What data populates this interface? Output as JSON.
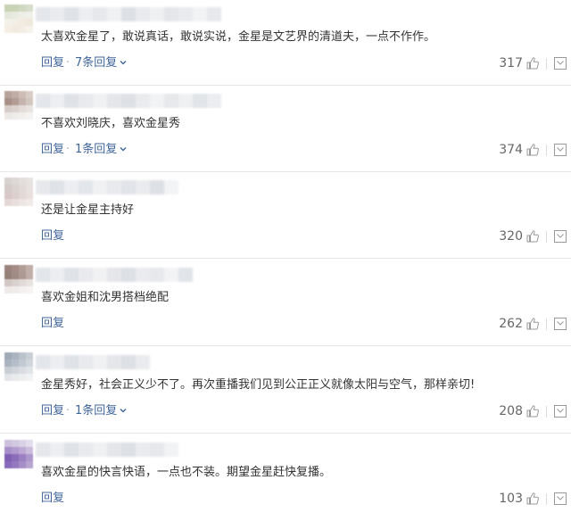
{
  "reply_label": "回复",
  "comments": [
    {
      "avatar_colors": [
        "#c7d3b4",
        "#c9d4b7",
        "#d0d8c2",
        "#d7ddcb",
        "#e4e8da",
        "#e8ebe0",
        "#eeeee6",
        "#f0f0ea",
        "#f4f1ea",
        "#f3efe6",
        "#f1ebe1",
        "#efe8dc",
        "#f5eee5",
        "#f2ebe1",
        "#f3ede5",
        "#f6f2ec"
      ],
      "name_colors": [
        "#e3e6ea",
        "#e9ebef",
        "#dfe2e7",
        "#eceef1",
        "#e6e8ec",
        "#f0f1f3",
        "#dde0e5",
        "#e8eaee",
        "#eff0f2",
        "#e4e6ea",
        "#eaebee",
        "#f2f3f5",
        "#e6e8eb"
      ],
      "text": "太喜欢金星了，敢说真话，敢说实说，金星是文艺界的清道夫，一点不作作。",
      "replies": "7条回复",
      "likes": "317"
    },
    {
      "avatar_colors": [
        "#b7a39c",
        "#c0ada6",
        "#cdbdb6",
        "#d8ccc6",
        "#a89088",
        "#b29c94",
        "#c5b4ad",
        "#d2c6c0",
        "#d7cdc8",
        "#dcd3ce",
        "#e3dcd8",
        "#e8e3e0",
        "#ece8e6",
        "#efebe9",
        "#f1eeec",
        "#f4f2f0"
      ],
      "name_colors": [
        "#e3e6ea",
        "#eceef1",
        "#dfe2e7",
        "#e8eaee",
        "#f0f1f3",
        "#e4e6ea",
        "#dde0e5",
        "#eaebee",
        "#f2f3f5",
        "#e6e8eb",
        "#eff0f2",
        "#e1e4e8",
        "#ebedf0"
      ],
      "text": "不喜欢刘晓庆，喜欢金星秀",
      "replies": "1条回复",
      "likes": "374"
    },
    {
      "avatar_colors": [
        "#d8d2d0",
        "#ddd7d5",
        "#e3dedc",
        "#e7e3e1",
        "#d4cbc8",
        "#dad2cf",
        "#e0d9d7",
        "#e6e0de",
        "#d7c8c6",
        "#dccfcd",
        "#e3d8d6",
        "#e9e0de",
        "#e4d8d6",
        "#e8dedc",
        "#ede5e3",
        "#f1eae8"
      ],
      "name_colors": [
        "#e6e8ec",
        "#dfe2e7",
        "#eceef1",
        "#e3e6ea",
        "#f0f1f3",
        "#e8eaee",
        "#e1e4e8",
        "#eaebee",
        "#dde0e5",
        "#f2f3f5"
      ],
      "text": "还是让金星主持好",
      "replies": "",
      "likes": "320"
    },
    {
      "avatar_colors": [
        "#9c827c",
        "#a58b85",
        "#b29c96",
        "#c1aea9",
        "#958079",
        "#a08a84",
        "#ad9993",
        "#bfaea9",
        "#d3c8c5",
        "#dad0cd",
        "#e2dad8",
        "#e8e2e0",
        "#eeeae9",
        "#f0eceb",
        "#f3f0ef",
        "#f6f4f3"
      ],
      "name_colors": [
        "#e3e6ea",
        "#eceef1",
        "#dfe2e7",
        "#e8eaee",
        "#f0f1f3",
        "#e4e6ea",
        "#dde0e5",
        "#eaebee",
        "#e6e8eb",
        "#f2f3f5",
        "#e1e4e8"
      ],
      "text": "喜欢金姐和沈男搭档绝配",
      "replies": "",
      "likes": "262"
    },
    {
      "avatar_colors": [
        "#9fa9b6",
        "#aab3bf",
        "#b9c1cb",
        "#c9ced6",
        "#a9b3c0",
        "#b4bdc8",
        "#c2c9d2",
        "#d1d6dd",
        "#c9ced5",
        "#d1d5db",
        "#dadde2",
        "#e2e5e8",
        "#e3e5e8",
        "#e8eaec",
        "#eceef0",
        "#f1f2f4"
      ],
      "name_colors": [
        "#e3e6ea",
        "#eceef1",
        "#dfe2e7",
        "#e8eaee",
        "#f0f1f3",
        "#e4e6ea",
        "#dde0e5",
        "#eaebee"
      ],
      "text": "金星秀好，社会正义少不了。再次重播我们见到公正正义就像太阳与空气，那样亲切!",
      "replies": "1条回复",
      "likes": "208"
    },
    {
      "avatar_colors": [
        "#ccc0dc",
        "#d2c8e0",
        "#d9d1e5",
        "#e2dcec",
        "#a98fc8",
        "#b19acd",
        "#bda9d4",
        "#cbbcdc",
        "#7f5fb2",
        "#8a6cb9",
        "#9a80c2",
        "#ad97cc",
        "#8868ba",
        "#9478bf",
        "#a58dc8",
        "#b7a4d1"
      ],
      "name_colors": [
        "#e3e6ea",
        "#eceef1",
        "#dfe2e7",
        "#e8eaee",
        "#f0f1f3",
        "#e4e6ea",
        "#dde0e5",
        "#eaebee",
        "#e6e8eb",
        "#f2f3f5"
      ],
      "text": "喜欢金星的快言快语，一点也不装。期望金星赶快复播。",
      "replies": "",
      "likes": "103"
    }
  ]
}
